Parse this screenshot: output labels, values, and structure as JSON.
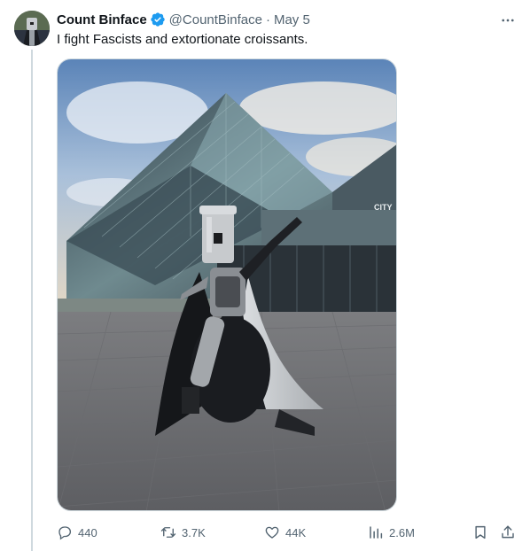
{
  "tweet": {
    "display_name": "Count Binface",
    "handle": "@CountBinface",
    "separator": "·",
    "date": "May 5",
    "text": "I fight Fascists and extortionate croissants.",
    "verified_color": "#1d9bf0"
  },
  "media": {
    "sign_text": "CITY"
  },
  "actions": {
    "replies": "440",
    "reposts": "3.7K",
    "likes": "44K",
    "views": "2.6M"
  },
  "icons": {
    "more": "more-horizontal-icon",
    "reply": "reply-icon",
    "repost": "repost-icon",
    "like": "heart-icon",
    "views": "analytics-icon",
    "bookmark": "bookmark-icon",
    "share": "share-icon",
    "verified": "verified-badge-icon"
  }
}
